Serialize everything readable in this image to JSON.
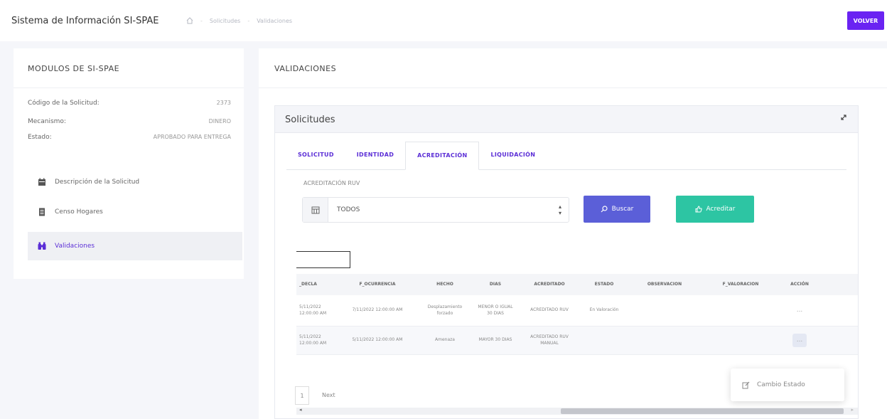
{
  "header": {
    "app_title": "Sistema de Información SI-SPAE",
    "breadcrumb": [
      "Solicitudes",
      "Validaciones"
    ],
    "back_label": "VOLVER"
  },
  "sidebar": {
    "title": "MODULOS DE SI-SPAE",
    "fields": [
      {
        "label": "Código de la Solicitud:",
        "value": "2373"
      },
      {
        "label": "Mecanismo:",
        "value": "DINERO"
      },
      {
        "label": "Estado:",
        "value": "APROBADO PARA ENTREGA"
      }
    ],
    "menu": [
      {
        "label": "Descripción de la Solicitud",
        "icon": "calendar-icon"
      },
      {
        "label": "Censo Hogares",
        "icon": "document-icon"
      },
      {
        "label": "Validaciones",
        "icon": "binoculars-icon"
      }
    ]
  },
  "main": {
    "title": "VALIDACIONES",
    "panel_title": "Solicitudes",
    "tabs": [
      "SOLICITUD",
      "IDENTIDAD",
      "ACREDITACIÓN",
      "LIQUIDACIÓN"
    ],
    "active_tab": "ACREDITACIÓN",
    "filter": {
      "label": "ACREDITACIÓN RUV",
      "selected": "TODOS"
    },
    "buttons": {
      "search": "Buscar",
      "accredit": "Acreditar"
    },
    "table": {
      "columns": [
        "_DECLA",
        "F_OCURRENCIA",
        "HECHO",
        "DIAS",
        "ACREDITADO",
        "ESTADO",
        "OBSERVACION",
        "F_VALORACION",
        "ACCIÓN"
      ],
      "rows": [
        [
          "5/11/2022 12:00:00 AM",
          "7/11/2022 12:00:00 AM",
          "Desplazamiento forzado",
          "MENOR O IGUAL 30 DIAS",
          "ACREDITADO RUV",
          "En Valoración",
          "",
          "",
          "..."
        ],
        [
          "5/11/2022 12:00:00 AM",
          "5/11/2022 12:00:00 AM",
          "Amenaza",
          "MAYOR 30 DIAS",
          "ACREDITADO RUV MANUAL",
          "",
          "",
          "",
          "..."
        ]
      ]
    },
    "pager": {
      "page": "1",
      "next": "Next"
    },
    "context_menu": {
      "item": "Cambio Estado"
    }
  }
}
